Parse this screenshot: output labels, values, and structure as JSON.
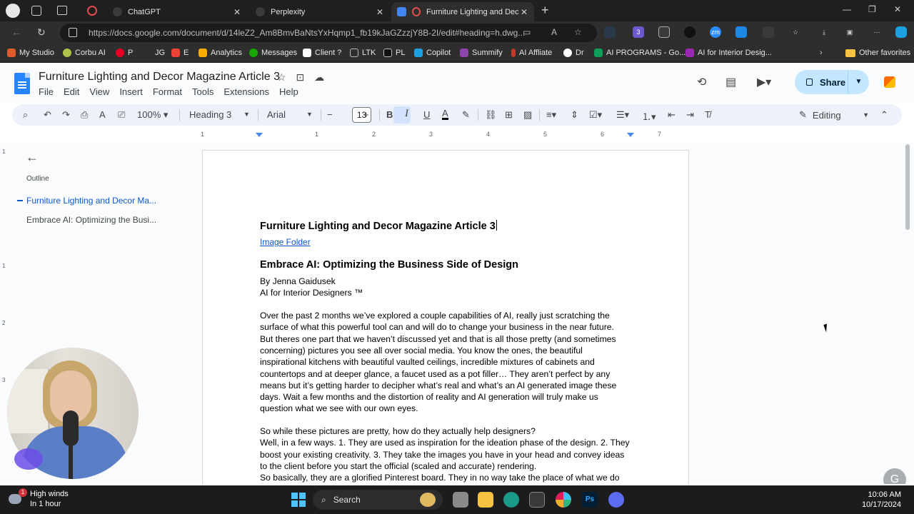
{
  "browser": {
    "tabs": [
      {
        "title": "ChatGPT",
        "active": false
      },
      {
        "title": "Perplexity",
        "active": false
      },
      {
        "title": "Furniture Lighting and Decor",
        "active": true
      }
    ],
    "url": "https://docs.google.com/document/d/14leZ2_Am8BmvBaNtsYxHqmp1_fb19kJaGZzzjY8B-2I/edit#heading=h.dwg...",
    "bookmarks": [
      "My Studio",
      "Corbu AI",
      "P",
      "JG",
      "E",
      "Analytics",
      "Messages",
      "Client ?",
      "LTK",
      "PL",
      "Copilot",
      "Summify",
      "AI Affliate",
      "Dr",
      "AI PROGRAMS - Go...",
      "AI for Interior Desig..."
    ],
    "other_favorites": "Other favorites",
    "ext_badge": "3"
  },
  "docs": {
    "title": "Furniture Lighting and Decor Magazine Article 3",
    "menu": [
      "File",
      "Edit",
      "View",
      "Insert",
      "Format",
      "Tools",
      "Extensions",
      "Help"
    ],
    "share_label": "Share",
    "toolbar": {
      "zoom": "100%",
      "style": "Heading 3",
      "font": "Arial",
      "font_size": "13",
      "mode": "Editing"
    },
    "ruler_numbers": [
      "1",
      "1",
      "2",
      "3",
      "4",
      "5",
      "6",
      "7"
    ],
    "vruler_numbers": [
      "1",
      "1",
      "2",
      "3"
    ]
  },
  "outline": {
    "label": "Outline",
    "items": [
      {
        "label": "Furniture Lighting and Decor Ma...",
        "active": true
      },
      {
        "label": "Embrace AI: Optimizing the Busi...",
        "active": false
      }
    ]
  },
  "document": {
    "title": "Furniture Lighting and Decor Magazine Article 3",
    "link": "Image Folder",
    "heading": "Embrace AI: Optimizing the Business Side of Design",
    "byline": "By Jenna Gaidusek",
    "org": "AI for Interior Designers ™",
    "para1": [
      "Over the past 2 months we’ve explored a couple capabilities of AI, really just scratching the",
      "surface of what this powerful tool can and will do to change your business in the near future.",
      "But theres one part that we haven’t discussed yet and that is all those pretty (and sometimes",
      "concerning) pictures you see all over social media. You know the ones, the beautiful",
      "inspirational kitchens with beautiful vaulted ceilings, incredible mixtures of cabinets and",
      "countertops and at deeper glance, a faucet used as a pot filler… They aren’t perfect by any",
      "means but it’s getting harder to decipher what’s real and what’s an AI generated image these",
      "days. Wait a few months and the distortion of reality and AI generation will truly make us",
      "question what we see with our own eyes."
    ],
    "para2": [
      "So while these pictures are pretty, how do they actually help designers?",
      "Well, in a few ways. 1. They are used as inspiration for the ideation phase of the design. 2. They",
      "boost your existing creativity. 3. They take the images you have in your head and convey ideas",
      "to the client before you start the official (scaled and accurate) rendering.",
      "So basically, they are a glorified Pinterest board. They in no way take the place of what we do"
    ]
  },
  "taskbar": {
    "weather_title": "High winds",
    "weather_sub": "In 1 hour",
    "weather_badge": "1",
    "search": "Search",
    "time": "10:06 AM",
    "date": "10/17/2024"
  },
  "colors": {
    "accent": "#0b57d0",
    "share_bg": "#c2e7ff",
    "toolbar_bg": "#edf2fa",
    "browser_bg": "#2e2e2e"
  }
}
